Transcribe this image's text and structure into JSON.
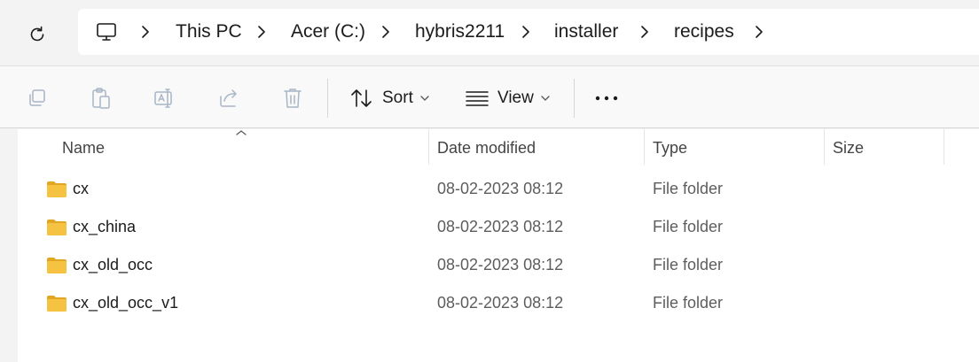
{
  "address": {
    "crumbs": [
      "This PC",
      "Acer (C:)",
      "hybris2211",
      "installer",
      "recipes"
    ]
  },
  "toolbar": {
    "sort_label": "Sort",
    "view_label": "View"
  },
  "columns": {
    "name": "Name",
    "date": "Date modified",
    "type": "Type",
    "size": "Size"
  },
  "files": [
    {
      "name": "cx",
      "date": "08-02-2023 08:12",
      "type": "File folder",
      "size": ""
    },
    {
      "name": "cx_china",
      "date": "08-02-2023 08:12",
      "type": "File folder",
      "size": ""
    },
    {
      "name": "cx_old_occ",
      "date": "08-02-2023 08:12",
      "type": "File folder",
      "size": ""
    },
    {
      "name": "cx_old_occ_v1",
      "date": "08-02-2023 08:12",
      "type": "File folder",
      "size": ""
    }
  ],
  "colors": {
    "folder": "#f5c242",
    "folder_dark": "#e1a722",
    "disabled_icon": "#a8b6c6"
  }
}
